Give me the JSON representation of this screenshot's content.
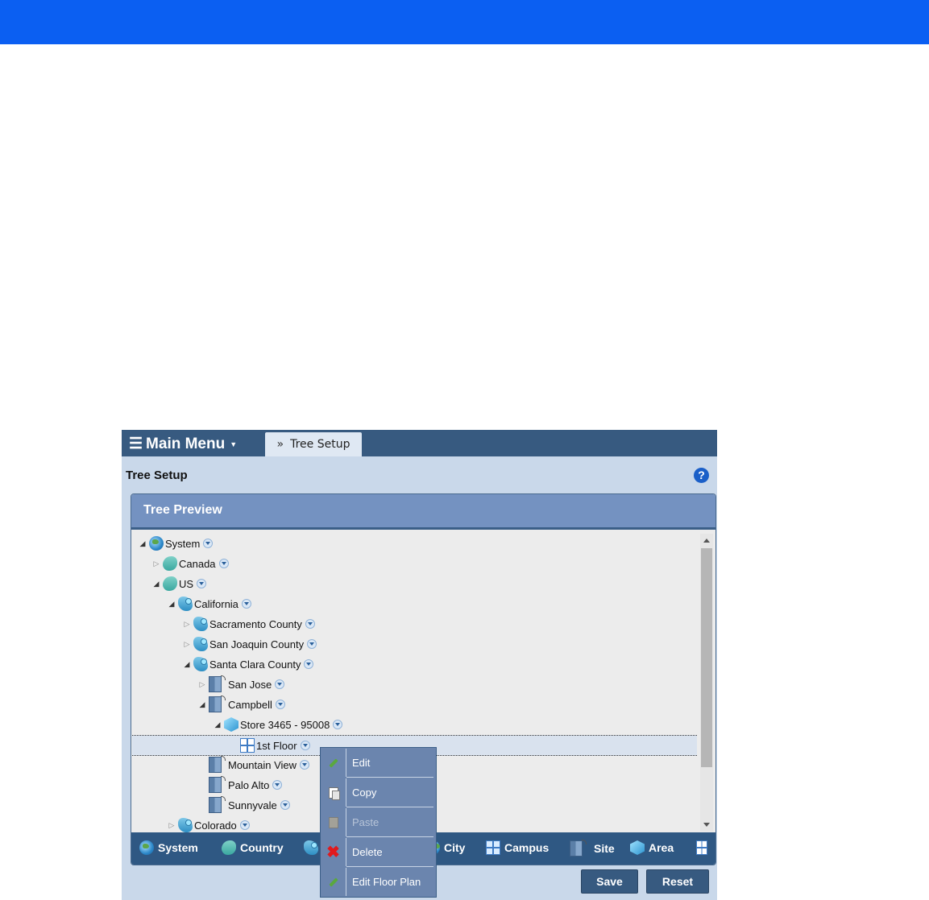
{
  "header": {
    "main_menu_label": "Main Menu",
    "tab_label": "Tree Setup",
    "page_title": "Tree Setup",
    "help_symbol": "?"
  },
  "panel": {
    "title": "Tree Preview"
  },
  "tree": [
    {
      "label": "System",
      "icon": "globe-icon",
      "state": "expanded"
    },
    {
      "label": "Canada",
      "icon": "country-icon",
      "state": "collapsed"
    },
    {
      "label": "US",
      "icon": "country-icon",
      "state": "expanded"
    },
    {
      "label": "California",
      "icon": "state-icon",
      "state": "expanded"
    },
    {
      "label": "Sacramento County",
      "icon": "county-icon",
      "state": "collapsed"
    },
    {
      "label": "San Joaquin County",
      "icon": "county-icon",
      "state": "collapsed"
    },
    {
      "label": "Santa Clara County",
      "icon": "county-icon",
      "state": "expanded"
    },
    {
      "label": "San Jose",
      "icon": "city-icon",
      "state": "collapsed"
    },
    {
      "label": "Campbell",
      "icon": "city-icon",
      "state": "expanded"
    },
    {
      "label": "Store 3465 - 95008",
      "icon": "area-icon",
      "state": "expanded"
    },
    {
      "label": "1st Floor",
      "icon": "floor-icon",
      "state": "leaf",
      "selected": true
    },
    {
      "label": "Mountain View",
      "icon": "city-icon",
      "state": "leaf"
    },
    {
      "label": "Palo Alto",
      "icon": "city-icon",
      "state": "leaf"
    },
    {
      "label": "Sunnyvale",
      "icon": "city-icon",
      "state": "leaf"
    },
    {
      "label": "Colorado",
      "icon": "state-icon",
      "state": "collapsed"
    }
  ],
  "legend": {
    "system": "System",
    "country": "Country",
    "city": "City",
    "campus": "Campus",
    "site": "Site",
    "area": "Area"
  },
  "buttons": {
    "save": "Save",
    "reset": "Reset"
  },
  "context_menu": {
    "edit": "Edit",
    "copy": "Copy",
    "paste": "Paste",
    "delete": "Delete",
    "edit_floor_plan": "Edit Floor Plan"
  },
  "colors": {
    "top_bar": "#0b5ff2",
    "tab_bar": "#375a80",
    "panel_header": "#7492c1",
    "delete_icon": "#e0191d"
  }
}
